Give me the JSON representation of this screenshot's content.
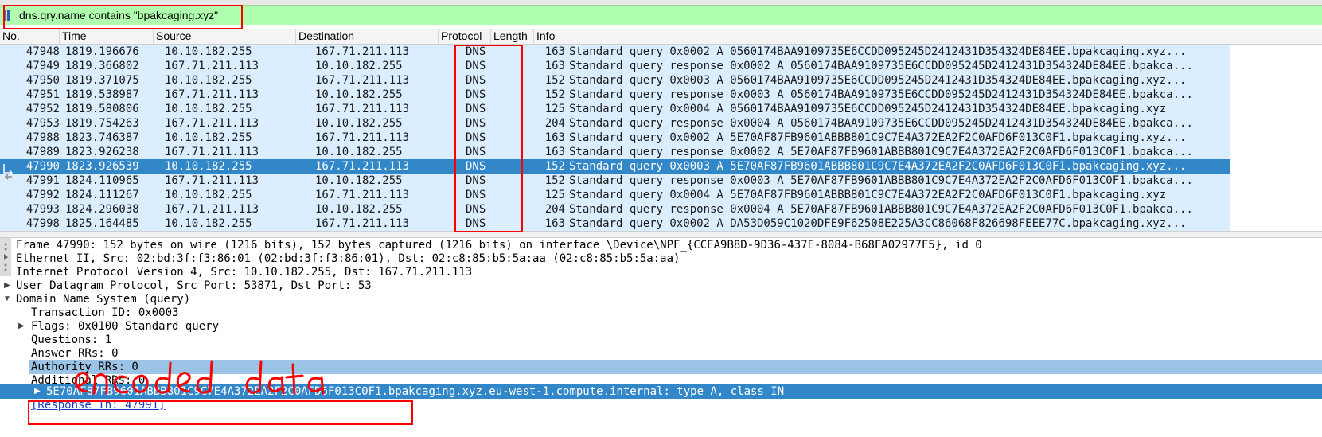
{
  "filter": {
    "expression": "dns.qry.name contains \"bpakcaging.xyz\""
  },
  "columns": [
    "No.",
    "Time",
    "Source",
    "Destination",
    "Protocol",
    "Length",
    "Info"
  ],
  "packets": [
    {
      "no": "47948",
      "time": "1819.196676",
      "src": "10.10.182.255",
      "dst": "167.71.211.113",
      "proto": "DNS",
      "len": "163",
      "info": "Standard query 0x0002 A 0560174BAA9109735E6CCDD095245D2412431D354324DE84EE.bpakcaging.xyz..."
    },
    {
      "no": "47949",
      "time": "1819.366802",
      "src": "167.71.211.113",
      "dst": "10.10.182.255",
      "proto": "DNS",
      "len": "163",
      "info": "Standard query response 0x0002 A 0560174BAA9109735E6CCDD095245D2412431D354324DE84EE.bpakca..."
    },
    {
      "no": "47950",
      "time": "1819.371075",
      "src": "10.10.182.255",
      "dst": "167.71.211.113",
      "proto": "DNS",
      "len": "152",
      "info": "Standard query 0x0003 A 0560174BAA9109735E6CCDD095245D2412431D354324DE84EE.bpakcaging.xyz..."
    },
    {
      "no": "47951",
      "time": "1819.538987",
      "src": "167.71.211.113",
      "dst": "10.10.182.255",
      "proto": "DNS",
      "len": "152",
      "info": "Standard query response 0x0003 A 0560174BAA9109735E6CCDD095245D2412431D354324DE84EE.bpakca..."
    },
    {
      "no": "47952",
      "time": "1819.580806",
      "src": "10.10.182.255",
      "dst": "167.71.211.113",
      "proto": "DNS",
      "len": "125",
      "info": "Standard query 0x0004 A 0560174BAA9109735E6CCDD095245D2412431D354324DE84EE.bpakcaging.xyz"
    },
    {
      "no": "47953",
      "time": "1819.754263",
      "src": "167.71.211.113",
      "dst": "10.10.182.255",
      "proto": "DNS",
      "len": "204",
      "info": "Standard query response 0x0004 A 0560174BAA9109735E6CCDD095245D2412431D354324DE84EE.bpakca..."
    },
    {
      "no": "47988",
      "time": "1823.746387",
      "src": "10.10.182.255",
      "dst": "167.71.211.113",
      "proto": "DNS",
      "len": "163",
      "info": "Standard query 0x0002 A 5E70AF87FB9601ABBB801C9C7E4A372EA2F2C0AFD6F013C0F1.bpakcaging.xyz..."
    },
    {
      "no": "47989",
      "time": "1823.926238",
      "src": "167.71.211.113",
      "dst": "10.10.182.255",
      "proto": "DNS",
      "len": "163",
      "info": "Standard query response 0x0002 A 5E70AF87FB9601ABBB801C9C7E4A372EA2F2C0AFD6F013C0F1.bpakca..."
    },
    {
      "no": "47990",
      "time": "1823.926539",
      "src": "10.10.182.255",
      "dst": "167.71.211.113",
      "proto": "DNS",
      "len": "152",
      "info": "Standard query 0x0003 A 5E70AF87FB9601ABBB801C9C7E4A372EA2F2C0AFD6F013C0F1.bpakcaging.xyz..."
    },
    {
      "no": "47991",
      "time": "1824.110965",
      "src": "167.71.211.113",
      "dst": "10.10.182.255",
      "proto": "DNS",
      "len": "152",
      "info": "Standard query response 0x0003 A 5E70AF87FB9601ABBB801C9C7E4A372EA2F2C0AFD6F013C0F1.bpakca..."
    },
    {
      "no": "47992",
      "time": "1824.111267",
      "src": "10.10.182.255",
      "dst": "167.71.211.113",
      "proto": "DNS",
      "len": "125",
      "info": "Standard query 0x0004 A 5E70AF87FB9601ABBB801C9C7E4A372EA2F2C0AFD6F013C0F1.bpakcaging.xyz"
    },
    {
      "no": "47993",
      "time": "1824.296038",
      "src": "167.71.211.113",
      "dst": "10.10.182.255",
      "proto": "DNS",
      "len": "204",
      "info": "Standard query response 0x0004 A 5E70AF87FB9601ABBB801C9C7E4A372EA2F2C0AFD6F013C0F1.bpakca..."
    },
    {
      "no": "47998",
      "time": "1825.164485",
      "src": "10.10.182.255",
      "dst": "167.71.211.113",
      "proto": "DNS",
      "len": "163",
      "info": "Standard query 0x0002 A DA53D059C1020DFE9F62508E225A3CC86068F826698FEEE77C.bpakcaging.xyz..."
    }
  ],
  "selected_packet": "47990",
  "details": {
    "frame": "Frame 47990: 152 bytes on wire (1216 bits), 152 bytes captured (1216 bits) on interface \\Device\\NPF_{CCEA9B8D-9D36-437E-8084-B68FA02977F5}, id 0",
    "ethernet": "Ethernet II, Src: 02:bd:3f:f3:86:01 (02:bd:3f:f3:86:01), Dst: 02:c8:85:b5:5a:aa (02:c8:85:b5:5a:aa)",
    "ip": "Internet Protocol Version 4, Src: 10.10.182.255, Dst: 167.71.211.113",
    "udp": "User Datagram Protocol, Src Port: 53871, Dst Port: 53",
    "dns": "Domain Name System (query)",
    "transaction_id": "Transaction ID: 0x0003",
    "flags": "Flags: 0x0100 Standard query",
    "questions": "Questions: 1",
    "answer_rrs": "Answer RRs: 0",
    "authority_rrs": "Authority RRs: 0",
    "additional_rrs": "Additional RRs: 0",
    "queries": "Queries",
    "query_encoded": "5E70AF87FB9601ABBB801C9C7E4A372EA2F2C0AFD6F013C0F1",
    "query_rest": ".bpakcaging.xyz.eu-west-1.compute.internal: type A, class IN",
    "response_in": "[Response In: 47991]"
  },
  "annotation": {
    "handwritten": "encoded data",
    "color": "#ff0000"
  },
  "colors": {
    "filter_bg": "#afffaf",
    "row_bg": "#dbeeff",
    "selected": "#3287c9",
    "highlight": "#9ac3e6"
  }
}
